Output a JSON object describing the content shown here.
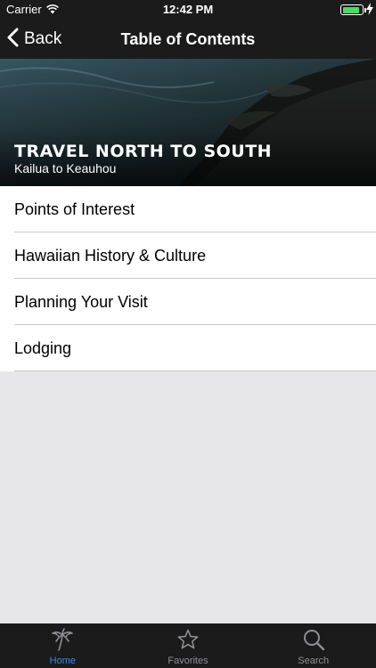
{
  "status_bar": {
    "carrier": "Carrier",
    "time": "12:42 PM",
    "battery_level": 0.9,
    "battery_color": "#4cd964"
  },
  "nav": {
    "back_label": "Back",
    "title": "Table of Contents"
  },
  "hero": {
    "title": "TRAVEL NORTH TO SOUTH",
    "subtitle": "Kailua to Keauhou"
  },
  "menu": {
    "items": [
      {
        "label": "Points of Interest"
      },
      {
        "label": "Hawaiian History & Culture"
      },
      {
        "label": "Planning Your Visit"
      },
      {
        "label": "Lodging"
      }
    ]
  },
  "tab_bar": {
    "tabs": [
      {
        "label": "Home",
        "icon": "palm-tree-icon",
        "active": true
      },
      {
        "label": "Favorites",
        "icon": "star-icon",
        "active": false
      },
      {
        "label": "Search",
        "icon": "search-icon",
        "active": false
      }
    ],
    "active_color": "#2f8bf5",
    "inactive_color": "#8e8e93"
  }
}
